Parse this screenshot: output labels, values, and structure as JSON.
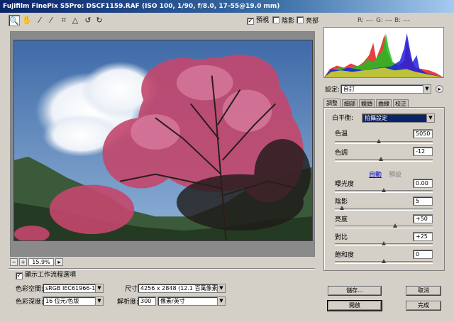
{
  "window": {
    "title": "Fujifilm FinePix S5Pro:  DSCF1159.RAF  (ISO 100, 1/90, f/8.0, 17-55@19.0 mm)"
  },
  "toolbar": {
    "tools": [
      {
        "name": "zoom-tool",
        "icon": "magnifier-icon",
        "glyph": "🔍"
      },
      {
        "name": "hand-tool",
        "icon": "hand-icon",
        "glyph": "✋"
      },
      {
        "name": "white-balance-tool",
        "icon": "eyedropper-icon",
        "glyph": "⁄"
      },
      {
        "name": "color-sampler-tool",
        "icon": "sampler-icon",
        "glyph": "⁄"
      },
      {
        "name": "crop-tool",
        "icon": "crop-icon",
        "glyph": "⌗"
      },
      {
        "name": "straighten-tool",
        "icon": "straighten-icon",
        "glyph": "△"
      },
      {
        "name": "rotate-left-tool",
        "icon": "rotate-left-icon",
        "glyph": "↺"
      },
      {
        "name": "rotate-right-tool",
        "icon": "rotate-right-icon",
        "glyph": "↻"
      }
    ],
    "preview_label": "預視",
    "preview_checked": true,
    "shadows_label": "陰影",
    "shadows_checked": false,
    "highlights_label": "亮部",
    "highlights_checked": false,
    "r": "R: ---",
    "g": "G: ---",
    "b": "B: ---"
  },
  "zoom": {
    "minus": "−",
    "plus": "+",
    "value": "15.9%",
    "arrow": "▸"
  },
  "workflow": {
    "show_label": "顯示工作流程選項",
    "show_checked": true,
    "colorspace_label": "色彩空間:",
    "colorspace_value": "sRGB IEC61966-1",
    "depth_label": "色彩深度:",
    "depth_value": "16 位元/色版",
    "size_label": "尺寸:",
    "size_value": "4256 x 2848 (12.1 百萬像素)",
    "resolution_label": "解析度:",
    "resolution_value": "300",
    "resolution_unit": "像素/英寸"
  },
  "settings": {
    "label": "設定:",
    "value": "自訂"
  },
  "tabs": [
    "調整",
    "細部",
    "鏡頭",
    "曲線",
    "校正"
  ],
  "adjust": {
    "wb_label": "白平衡:",
    "wb_value": "拍攝設定",
    "temp_label": "色溫",
    "temp_value": "5050",
    "temp_pos": 0.45,
    "tint_label": "色調",
    "tint_value": "-12",
    "tint_pos": 0.47,
    "auto_label": "自動",
    "default_label": "預設",
    "exposure_label": "曝光度",
    "exposure_value": "0.00",
    "exposure_pos": 0.5,
    "shadows_label": "陰影",
    "shadows_value": "5",
    "shadows_pos": 0.05,
    "brightness_label": "亮度",
    "brightness_value": "+50",
    "brightness_pos": 0.62,
    "contrast_label": "對比",
    "contrast_value": "+25",
    "contrast_pos": 0.5,
    "saturation_label": "飽和度",
    "saturation_value": "0",
    "saturation_pos": 0.5
  },
  "buttons": {
    "save": "儲存...",
    "cancel": "取消",
    "open": "開啟",
    "done": "完成"
  },
  "colors": {
    "title_start": "#0a246a",
    "title_end": "#a6caf0",
    "face": "#d4d0c8",
    "selection": "#0a246a"
  }
}
